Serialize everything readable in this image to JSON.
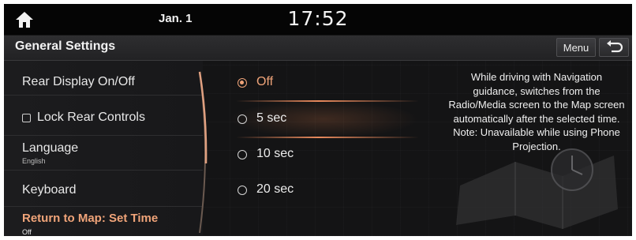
{
  "status_bar": {
    "date": "Jan. 1",
    "time": "17:52"
  },
  "header": {
    "title": "General Settings",
    "menu_label": "Menu"
  },
  "settings_list": [
    {
      "label": "Rear Display On/Off",
      "sub": ""
    },
    {
      "label": "Lock Rear Controls",
      "sub": "",
      "checked": false
    },
    {
      "label": "Language",
      "sub": "English"
    },
    {
      "label": "Keyboard",
      "sub": ""
    },
    {
      "label": "Return to Map: Set Time",
      "sub": "Off",
      "selected": true
    }
  ],
  "options": [
    {
      "label": "Off",
      "selected": true
    },
    {
      "label": "5 sec",
      "selected": false
    },
    {
      "label": "10 sec",
      "selected": false
    },
    {
      "label": "20 sec",
      "selected": false
    }
  ],
  "description": "While driving with Navigation guidance, switches from the Radio/Media screen to the Map screen automatically after the selected time. Note: Unavailable while using Phone Projection.",
  "colors": {
    "accent": "#f0a479",
    "background": "#141415"
  },
  "icons": {
    "home": "home-icon",
    "back": "back-arrow-icon",
    "checkbox": "checkbox-icon",
    "radio": "radio-icon"
  }
}
